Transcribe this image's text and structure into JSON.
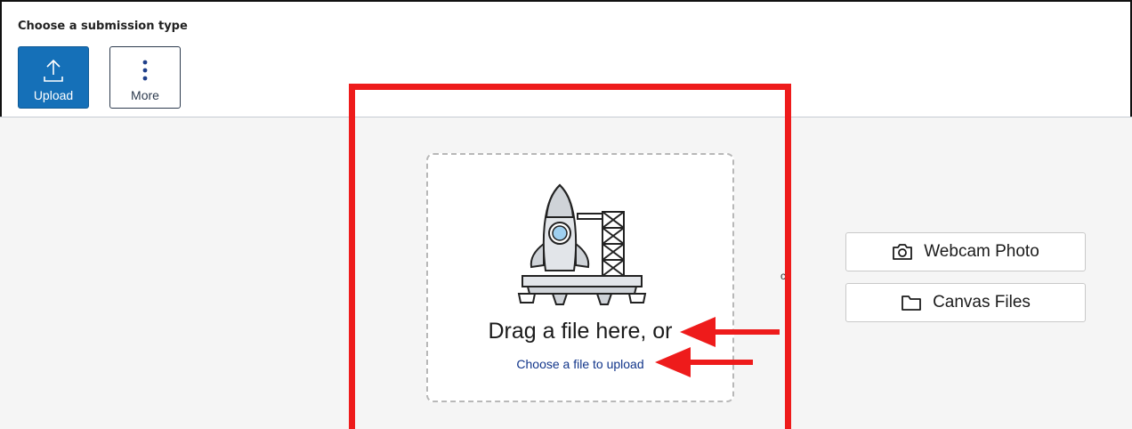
{
  "submission": {
    "heading": "Choose a submission type",
    "types": [
      {
        "label": "Upload",
        "icon": "upload-icon",
        "selected": true
      },
      {
        "label": "More",
        "icon": "more-vertical-icon",
        "selected": false
      }
    ]
  },
  "dropzone": {
    "illustration": "rocket-launch-illustration",
    "drag_text": "Drag a file here, or",
    "choose_link": "Choose a file to upload"
  },
  "side_buttons": {
    "webcam": {
      "label": "Webcam Photo",
      "icon": "camera-icon"
    },
    "canvas": {
      "label": "Canvas Files",
      "icon": "folder-icon"
    }
  },
  "stray_text": "c",
  "annotations": {
    "highlight_color": "#ee1b1b",
    "arrows": [
      "arrow-to-drag-text",
      "arrow-to-choose-link"
    ]
  },
  "colors": {
    "primary": "#1570b8",
    "link": "#11358a",
    "background": "#f5f5f5"
  }
}
